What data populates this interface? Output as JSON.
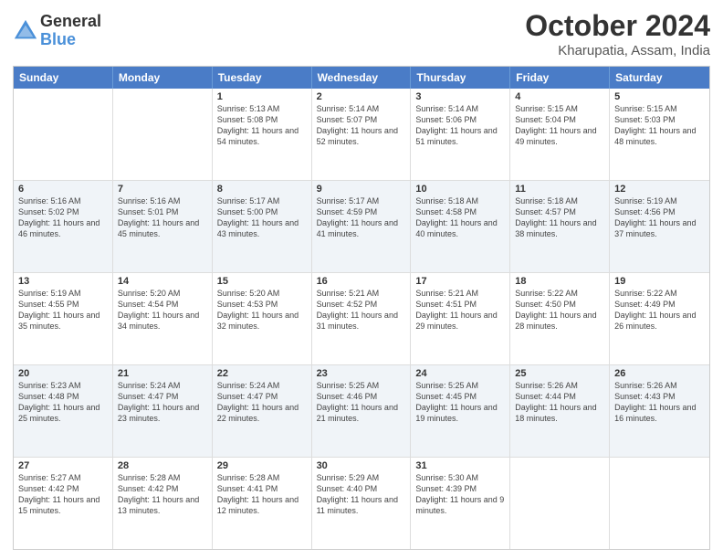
{
  "header": {
    "logo_general": "General",
    "logo_blue": "Blue",
    "title": "October 2024",
    "subtitle": "Kharupatia, Assam, India"
  },
  "days_of_week": [
    "Sunday",
    "Monday",
    "Tuesday",
    "Wednesday",
    "Thursday",
    "Friday",
    "Saturday"
  ],
  "weeks": [
    [
      {
        "day": "",
        "info": ""
      },
      {
        "day": "",
        "info": ""
      },
      {
        "day": "1",
        "info": "Sunrise: 5:13 AM\nSunset: 5:08 PM\nDaylight: 11 hours and 54 minutes."
      },
      {
        "day": "2",
        "info": "Sunrise: 5:14 AM\nSunset: 5:07 PM\nDaylight: 11 hours and 52 minutes."
      },
      {
        "day": "3",
        "info": "Sunrise: 5:14 AM\nSunset: 5:06 PM\nDaylight: 11 hours and 51 minutes."
      },
      {
        "day": "4",
        "info": "Sunrise: 5:15 AM\nSunset: 5:04 PM\nDaylight: 11 hours and 49 minutes."
      },
      {
        "day": "5",
        "info": "Sunrise: 5:15 AM\nSunset: 5:03 PM\nDaylight: 11 hours and 48 minutes."
      }
    ],
    [
      {
        "day": "6",
        "info": "Sunrise: 5:16 AM\nSunset: 5:02 PM\nDaylight: 11 hours and 46 minutes."
      },
      {
        "day": "7",
        "info": "Sunrise: 5:16 AM\nSunset: 5:01 PM\nDaylight: 11 hours and 45 minutes."
      },
      {
        "day": "8",
        "info": "Sunrise: 5:17 AM\nSunset: 5:00 PM\nDaylight: 11 hours and 43 minutes."
      },
      {
        "day": "9",
        "info": "Sunrise: 5:17 AM\nSunset: 4:59 PM\nDaylight: 11 hours and 41 minutes."
      },
      {
        "day": "10",
        "info": "Sunrise: 5:18 AM\nSunset: 4:58 PM\nDaylight: 11 hours and 40 minutes."
      },
      {
        "day": "11",
        "info": "Sunrise: 5:18 AM\nSunset: 4:57 PM\nDaylight: 11 hours and 38 minutes."
      },
      {
        "day": "12",
        "info": "Sunrise: 5:19 AM\nSunset: 4:56 PM\nDaylight: 11 hours and 37 minutes."
      }
    ],
    [
      {
        "day": "13",
        "info": "Sunrise: 5:19 AM\nSunset: 4:55 PM\nDaylight: 11 hours and 35 minutes."
      },
      {
        "day": "14",
        "info": "Sunrise: 5:20 AM\nSunset: 4:54 PM\nDaylight: 11 hours and 34 minutes."
      },
      {
        "day": "15",
        "info": "Sunrise: 5:20 AM\nSunset: 4:53 PM\nDaylight: 11 hours and 32 minutes."
      },
      {
        "day": "16",
        "info": "Sunrise: 5:21 AM\nSunset: 4:52 PM\nDaylight: 11 hours and 31 minutes."
      },
      {
        "day": "17",
        "info": "Sunrise: 5:21 AM\nSunset: 4:51 PM\nDaylight: 11 hours and 29 minutes."
      },
      {
        "day": "18",
        "info": "Sunrise: 5:22 AM\nSunset: 4:50 PM\nDaylight: 11 hours and 28 minutes."
      },
      {
        "day": "19",
        "info": "Sunrise: 5:22 AM\nSunset: 4:49 PM\nDaylight: 11 hours and 26 minutes."
      }
    ],
    [
      {
        "day": "20",
        "info": "Sunrise: 5:23 AM\nSunset: 4:48 PM\nDaylight: 11 hours and 25 minutes."
      },
      {
        "day": "21",
        "info": "Sunrise: 5:24 AM\nSunset: 4:47 PM\nDaylight: 11 hours and 23 minutes."
      },
      {
        "day": "22",
        "info": "Sunrise: 5:24 AM\nSunset: 4:47 PM\nDaylight: 11 hours and 22 minutes."
      },
      {
        "day": "23",
        "info": "Sunrise: 5:25 AM\nSunset: 4:46 PM\nDaylight: 11 hours and 21 minutes."
      },
      {
        "day": "24",
        "info": "Sunrise: 5:25 AM\nSunset: 4:45 PM\nDaylight: 11 hours and 19 minutes."
      },
      {
        "day": "25",
        "info": "Sunrise: 5:26 AM\nSunset: 4:44 PM\nDaylight: 11 hours and 18 minutes."
      },
      {
        "day": "26",
        "info": "Sunrise: 5:26 AM\nSunset: 4:43 PM\nDaylight: 11 hours and 16 minutes."
      }
    ],
    [
      {
        "day": "27",
        "info": "Sunrise: 5:27 AM\nSunset: 4:42 PM\nDaylight: 11 hours and 15 minutes."
      },
      {
        "day": "28",
        "info": "Sunrise: 5:28 AM\nSunset: 4:42 PM\nDaylight: 11 hours and 13 minutes."
      },
      {
        "day": "29",
        "info": "Sunrise: 5:28 AM\nSunset: 4:41 PM\nDaylight: 11 hours and 12 minutes."
      },
      {
        "day": "30",
        "info": "Sunrise: 5:29 AM\nSunset: 4:40 PM\nDaylight: 11 hours and 11 minutes."
      },
      {
        "day": "31",
        "info": "Sunrise: 5:30 AM\nSunset: 4:39 PM\nDaylight: 11 hours and 9 minutes."
      },
      {
        "day": "",
        "info": ""
      },
      {
        "day": "",
        "info": ""
      }
    ]
  ]
}
